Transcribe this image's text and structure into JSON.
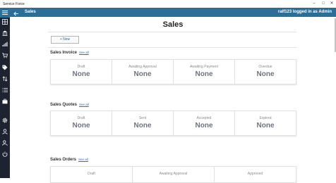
{
  "window": {
    "title": "Service Force"
  },
  "header": {
    "title": "Sales",
    "user_text": "ralf123 logged in as Admin"
  },
  "page": {
    "title": "Sales",
    "new_label": "+ New"
  },
  "see_all": "See all",
  "sections": [
    {
      "title": "Sales Invoice",
      "cards": [
        {
          "label": "Draft",
          "value": "None"
        },
        {
          "label": "Awaiting Approval",
          "value": "None"
        },
        {
          "label": "Awaiting Payment",
          "value": "None"
        },
        {
          "label": "Overdue",
          "value": "None"
        }
      ]
    },
    {
      "title": "Sales Quotes",
      "cards": [
        {
          "label": "Draft",
          "value": "None"
        },
        {
          "label": "Sent",
          "value": "None"
        },
        {
          "label": "Accepted",
          "value": "None"
        },
        {
          "label": "Expired",
          "value": "None"
        }
      ]
    },
    {
      "title": "Sales Orders",
      "cards": [
        {
          "label": "Draft",
          "value": ""
        },
        {
          "label": "Awaiting Approval",
          "value": ""
        },
        {
          "label": "Approved",
          "value": ""
        }
      ]
    }
  ],
  "nav_icons": [
    "menu-icon",
    "dashboard-icon",
    "bank-icon",
    "chart-icon",
    "cart-icon",
    "tag-icon",
    "transfer-icon",
    "list-icon",
    "briefcase-icon",
    "settings-icon",
    "person-icon",
    "person-search-icon",
    "power-icon"
  ],
  "colors": {
    "accent": "#2b6e97",
    "rail": "#1d2330"
  }
}
